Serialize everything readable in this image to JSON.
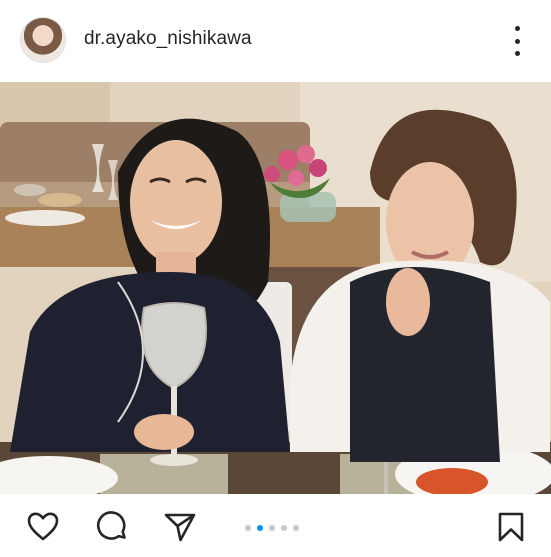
{
  "post": {
    "username": "dr.ayako_nishikawa",
    "carousel": {
      "total_slides": 5,
      "active_index": 1
    }
  },
  "icons": {
    "avatar": "profile-avatar",
    "more": "more-options-icon",
    "like": "heart-icon",
    "comment": "comment-bubble-icon",
    "share": "paper-plane-icon",
    "save": "bookmark-icon"
  },
  "colors": {
    "text": "#262626",
    "carousel_active": "#0095f6",
    "carousel_inactive": "#c7c7c7"
  }
}
